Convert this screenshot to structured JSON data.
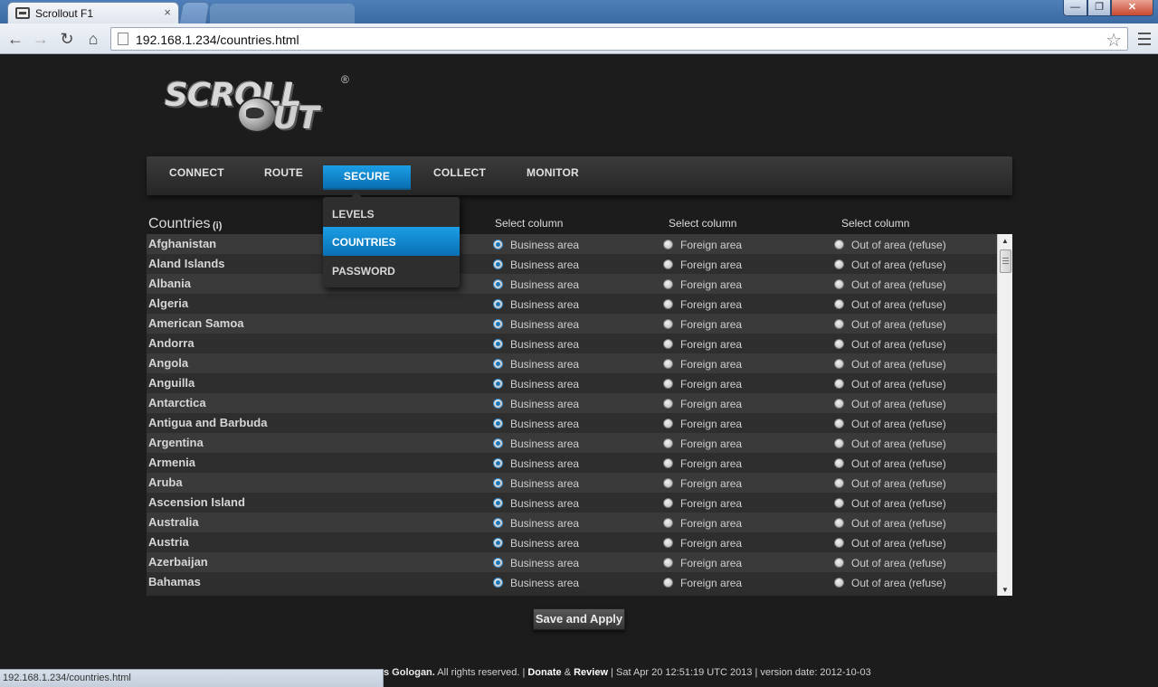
{
  "browser": {
    "tab_title": "Scrollout F1",
    "tab_close": "×",
    "url": "192.168.1.234/countries.html",
    "status_url": "192.168.1.234/countries.html",
    "win_min": "—",
    "win_max": "❐",
    "win_close": "✕"
  },
  "logo": {
    "top": "SCROLL",
    "bottom": "UT",
    "reg": "®"
  },
  "nav": {
    "items": [
      "CONNECT",
      "ROUTE",
      "SECURE",
      "COLLECT",
      "MONITOR"
    ],
    "active": "SECURE",
    "dropdown": [
      "LEVELS",
      "COUNTRIES",
      "PASSWORD"
    ],
    "dropdown_active": "COUNTRIES"
  },
  "table": {
    "title": "Countries",
    "info_marker": "(i)",
    "column_heads": [
      "Select column",
      "Select column",
      "Select column"
    ],
    "option_labels": [
      "Business area",
      "Foreign area",
      "Out of area (refuse)"
    ],
    "rows": [
      {
        "name": "Afghanistan",
        "selected": 0
      },
      {
        "name": "Aland Islands",
        "selected": 0
      },
      {
        "name": "Albania",
        "selected": 0
      },
      {
        "name": "Algeria",
        "selected": 0
      },
      {
        "name": "American Samoa",
        "selected": 0
      },
      {
        "name": "Andorra",
        "selected": 0
      },
      {
        "name": "Angola",
        "selected": 0
      },
      {
        "name": "Anguilla",
        "selected": 0
      },
      {
        "name": "Antarctica",
        "selected": 0
      },
      {
        "name": "Antigua and Barbuda",
        "selected": 0
      },
      {
        "name": "Argentina",
        "selected": 0
      },
      {
        "name": "Armenia",
        "selected": 0
      },
      {
        "name": "Aruba",
        "selected": 0
      },
      {
        "name": "Ascension Island",
        "selected": 0
      },
      {
        "name": "Australia",
        "selected": 0
      },
      {
        "name": "Austria",
        "selected": 0
      },
      {
        "name": "Azerbaijan",
        "selected": 0
      },
      {
        "name": "Bahamas",
        "selected": 0
      }
    ]
  },
  "actions": {
    "save_label": "Save and Apply"
  },
  "footer": {
    "author_tail": "s Gologan.",
    "rights": " All rights reserved. | ",
    "donate": "Donate",
    "amp": " & ",
    "review": "Review",
    "datetime": " | Sat Apr 20 12:51:19 UTC 2013 | version date: 2012-10-03"
  },
  "colors": {
    "accent": "#0a88d4",
    "background": "#1c1c1c",
    "row_odd": "#3a3a3a",
    "row_even": "#2e2e2e"
  },
  "icons": [
    "back-arrow-icon",
    "forward-arrow-icon",
    "reload-icon",
    "home-icon",
    "star-icon",
    "wrench-icon",
    "page-icon"
  ]
}
